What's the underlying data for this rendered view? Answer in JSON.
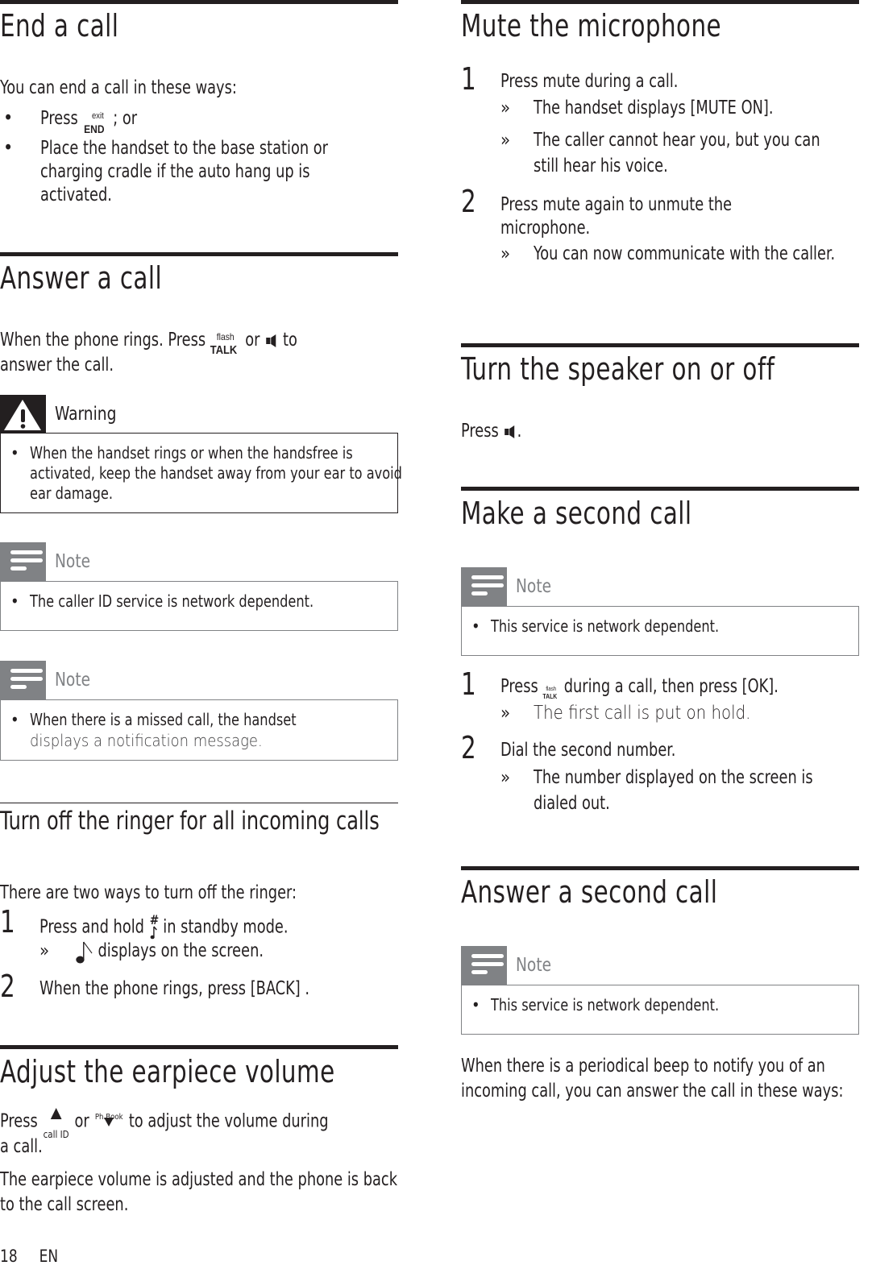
{
  "page": {
    "number": "18",
    "language": "EN"
  },
  "left": {
    "end_call": {
      "title": "End a call",
      "intro": "You can end a call in these ways:",
      "bullets": [
        {
          "pre": "Press",
          "key_sup": "exit",
          "key_main": "END",
          "post": "; or"
        },
        {
          "text": "Place the handset to the base station or charging cradle if the auto hang up is activated."
        }
      ]
    },
    "answer_call": {
      "title": "Answer a call",
      "text_pre": "When the phone rings. Press",
      "key_sup": "flash",
      "key_main": "TALK",
      "text_mid": "or",
      "text_post": "to",
      "text_line2": "answer the call.",
      "warning": {
        "label": "Warning",
        "icon": "warning-triangle-icon",
        "text": "When the handset rings or when the handsfree is activated, keep the handset away from your ear to avoid ear damage."
      },
      "notes": [
        {
          "label": "Note",
          "icon": "note-icon",
          "text": "The caller ID service is network dependent."
        },
        {
          "label": "Note",
          "icon": "note-icon",
          "text_line1": "When there is a missed call, the handset",
          "text_line2": "displays a notification message."
        }
      ]
    },
    "ringer_off": {
      "title": "Turn off the ringer for all incoming calls",
      "intro": "There are two ways to turn off the ringer:",
      "steps": [
        {
          "num": "1",
          "pre": "Press and hold",
          "icon": "hash-ringer-key-icon",
          "post": "in standby mode.",
          "result_icon": "ringer-off-icon",
          "result": "displays on the screen."
        },
        {
          "num": "2",
          "text": "When the phone rings, press [BACK] ."
        }
      ],
      "result_marker": "»"
    },
    "earpiece_volume": {
      "title": "Adjust the earpiece volume",
      "pre": "Press",
      "up_key_label": "call ID",
      "mid": "or",
      "down_key_label": "Ph.Book",
      "post": "to adjust the volume during",
      "line2": "a call.",
      "para2": "The earpiece volume is adjusted and the phone is back to the call screen."
    }
  },
  "right": {
    "mute": {
      "title": "Mute the microphone",
      "steps": [
        {
          "num": "1",
          "text": "Press mute during a call.",
          "results": [
            "The handset displays [MUTE ON].",
            "The caller cannot hear you, but you can still hear his voice."
          ]
        },
        {
          "num": "2",
          "text": "Press mute again to unmute the microphone.",
          "results": [
            "You can now communicate with the caller."
          ]
        }
      ],
      "result_marker": "»"
    },
    "speaker": {
      "title": "Turn the speaker on or off",
      "pre": "Press",
      "post": "."
    },
    "second_call": {
      "title": "Make a second call",
      "note": {
        "label": "Note",
        "text": "This service is network dependent."
      },
      "steps": [
        {
          "num": "1",
          "pre": "Press",
          "key_sup": "flash",
          "key_main": "TALK",
          "post": "during a call, then press [OK].",
          "result": "The first call is put on hold."
        },
        {
          "num": "2",
          "text": "Dial the second number.",
          "result": "The number displayed on the screen is dialed out."
        }
      ]
    },
    "answer_second": {
      "title": "Answer a second call",
      "note": {
        "label": "Note",
        "text": "This service is network dependent."
      },
      "para": "When there is a periodical beep to notify you of an incoming call, you can answer the call in these ways:"
    }
  }
}
